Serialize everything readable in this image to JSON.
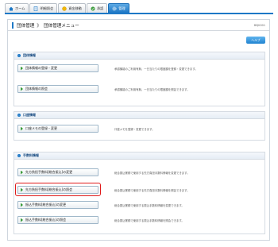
{
  "tabs": [
    {
      "label": "ホーム",
      "icon": "home-icon"
    },
    {
      "label": "明細照会",
      "icon": "document-icon"
    },
    {
      "label": "資金移動",
      "icon": "money-icon"
    },
    {
      "label": "承認",
      "icon": "check-icon"
    },
    {
      "label": "管理",
      "icon": "gear-icon"
    }
  ],
  "breadcrumb": {
    "root": "団体管理",
    "separator": "》",
    "current": "団体管理メニュー"
  },
  "screen_code": "BSJK001",
  "help_label": "ヘルプ",
  "sections": [
    {
      "title": "団体情報",
      "items": [
        {
          "label": "団体情報の登録・変更",
          "desc": "承認機能のご利用有無、一日当たりの限度額を登録・変更できます。"
        },
        {
          "label": "団体情報の照会",
          "desc": "承認機能のご利用有無、一日当たりの限度額を照会できます。"
        }
      ]
    },
    {
      "title": "口座情報",
      "items": [
        {
          "label": "口座メモの登録・変更",
          "desc": "口座メモを登録・変更できます。"
        }
      ]
    },
    {
      "title": "手数料情報",
      "items": [
        {
          "label": "先方負担手数料[総合振込]の変更",
          "desc": "総合振込業務で使用する先方負担手数料情報を変更できます。"
        },
        {
          "label": "先方負担手数料[総合振込]の照会",
          "desc": "総合振込業務で使用する先方負担手数料情報を照会できます。"
        },
        {
          "label": "振込手数料[総合振込]の変更",
          "desc": "総合振込業務で使用する振込手数料情報を変更できます。"
        },
        {
          "label": "振込手数料[総合振込]の照会",
          "desc": "総合振込業務で使用する振込手数料情報を照会できます。"
        }
      ]
    }
  ],
  "colors": {
    "accent": "#1d78c6",
    "highlight": "#e01b1b",
    "arrow": "#3a9b3a"
  }
}
